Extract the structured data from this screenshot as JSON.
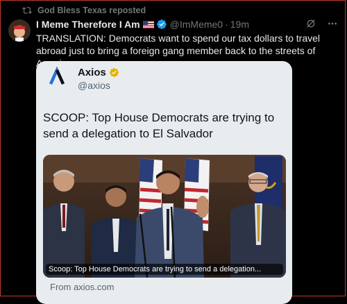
{
  "repost": {
    "label": "God Bless Texas reposted",
    "icon": "repost-icon"
  },
  "tweet": {
    "display_name": "I Meme Therefore I Am",
    "flag": "us-flag-emoji",
    "verified_color": "#1d9bf0",
    "handle": "@ImMeme0",
    "separator": "·",
    "time": "19m",
    "text": "TRANSLATION: Democrats want to spend our tax dollars to travel abroad just to bring a foreign gang member back to the streets of America."
  },
  "quoted": {
    "name": "Axios",
    "handle": "@axios",
    "verified_color": "#f5c400",
    "headline": "SCOOP: Top House Democrats are trying to send a delegation to El Salvador",
    "image_caption": "Scoop: Top House Democrats are trying to send a delegation...",
    "domain": "From axios.com",
    "brand_color": "#2a6fdb"
  },
  "colors": {
    "background": "#000000",
    "text": "#e7e9ea",
    "muted": "#71767b",
    "card_bg": "#e9ecef"
  }
}
